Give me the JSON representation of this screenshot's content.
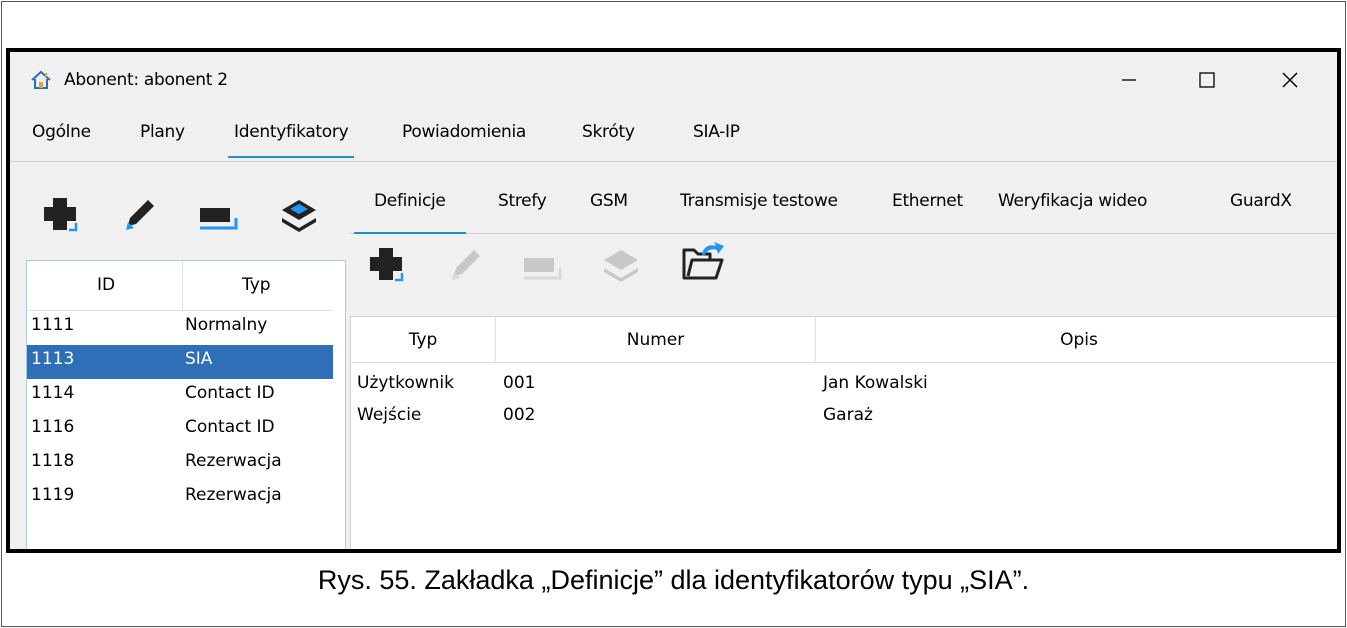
{
  "window": {
    "title": "Abonent: abonent 2",
    "minimize_icon": "minimize-icon",
    "maximize_icon": "maximize-icon",
    "close_icon": "close-icon"
  },
  "main_tabs": [
    "Ogólne",
    "Plany",
    "Identyfikatory",
    "Powiadomienia",
    "Skróty",
    "SIA-IP"
  ],
  "main_tab_active": "Identyfikatory",
  "left_toolbar": {
    "icons": [
      "add-icon",
      "edit-icon",
      "remove-icon",
      "layers-icon"
    ],
    "accent": "#2196f3"
  },
  "id_list": {
    "headers": {
      "id": "ID",
      "type": "Typ"
    },
    "rows": [
      {
        "id": "1111",
        "type": "Normalny"
      },
      {
        "id": "1113",
        "type": "SIA"
      },
      {
        "id": "1114",
        "type": "Contact ID"
      },
      {
        "id": "1116",
        "type": "Contact ID"
      },
      {
        "id": "1118",
        "type": "Rezerwacja"
      },
      {
        "id": "1119",
        "type": "Rezerwacja"
      }
    ],
    "selected_id": "1113",
    "selection_color": "#2f6fb7"
  },
  "sub_tabs": [
    "Definicje",
    "Strefy",
    "GSM",
    "Transmisje testowe",
    "Ethernet",
    "Weryfikacja wideo",
    "GuardX"
  ],
  "sub_tab_active": "Definicje",
  "def_toolbar": {
    "icons": [
      "add-icon",
      "edit-icon",
      "remove-icon",
      "layers-icon",
      "open-folder-icon"
    ]
  },
  "def_table": {
    "headers": {
      "type": "Typ",
      "number": "Numer",
      "description": "Opis"
    },
    "rows": [
      {
        "type": "Użytkownik",
        "number": "001",
        "description": "Jan Kowalski"
      },
      {
        "type": "Wejście",
        "number": "002",
        "description": "Garaż"
      }
    ]
  },
  "caption": "Rys. 55. Zakładka „Definicje” dla identyfikatorów typu „SIA”."
}
